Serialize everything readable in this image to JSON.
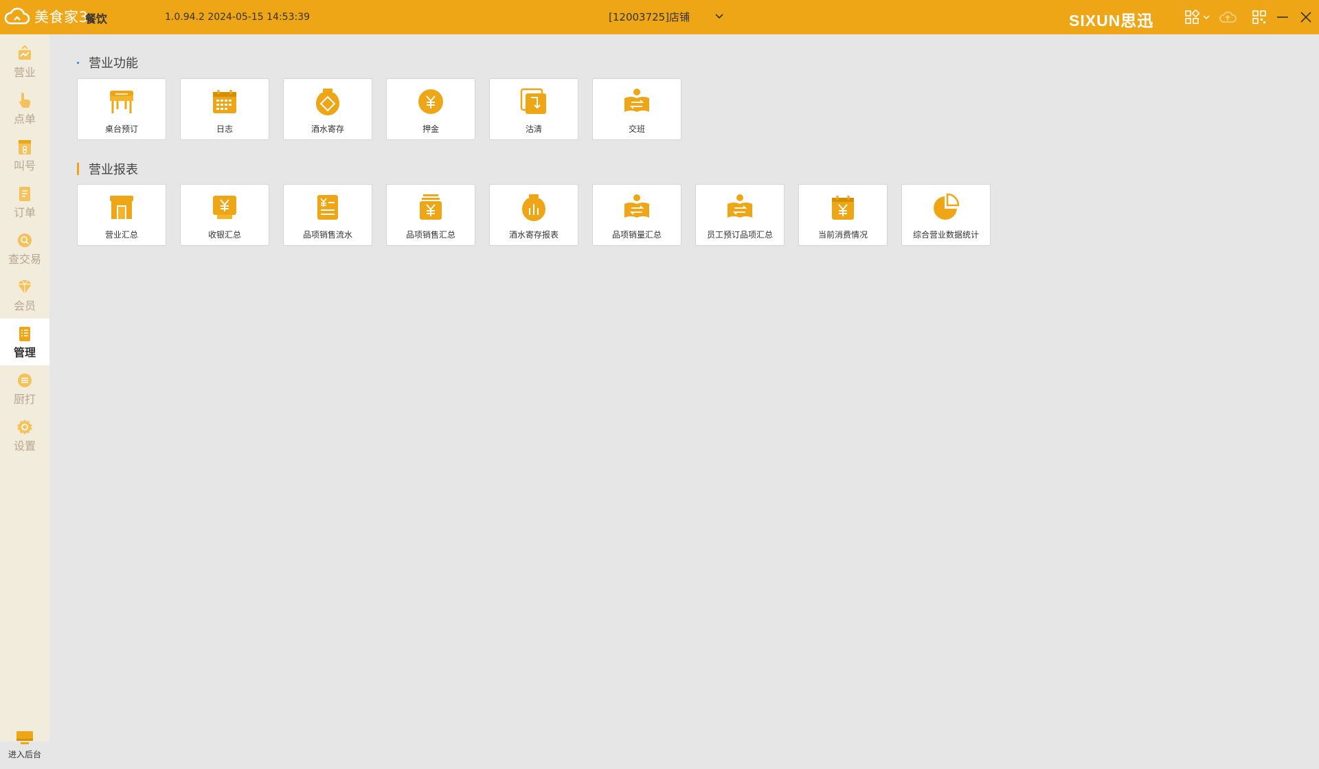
{
  "titlebar": {
    "app_name": "美食家3",
    "mode": "餐饮",
    "version": "1.0.94.2 2024-05-15 14:53:39",
    "store": "[12003725]店铺",
    "brand_text": "SIXUN",
    "brand_cn": "思迅"
  },
  "sidebar": {
    "items": [
      {
        "label": "营业",
        "icon": "business-icon"
      },
      {
        "label": "点单",
        "icon": "order-icon"
      },
      {
        "label": "叫号",
        "icon": "call-number-icon"
      },
      {
        "label": "订单",
        "icon": "orders-list-icon"
      },
      {
        "label": "查交易",
        "icon": "search-transaction-icon"
      },
      {
        "label": "会员",
        "icon": "member-icon"
      },
      {
        "label": "管理",
        "icon": "manage-icon"
      },
      {
        "label": "厨打",
        "icon": "kitchen-print-icon"
      },
      {
        "label": "设置",
        "icon": "settings-icon"
      }
    ],
    "active_index": 6,
    "backend_label": "进入后台"
  },
  "sections": {
    "business_functions": {
      "title": "营业功能",
      "tiles": [
        {
          "label": "桌台预订",
          "icon": "table-reservation-icon"
        },
        {
          "label": "日志",
          "icon": "log-icon"
        },
        {
          "label": "酒水寄存",
          "icon": "drink-storage-icon"
        },
        {
          "label": "押金",
          "icon": "deposit-icon"
        },
        {
          "label": "沽清",
          "icon": "sold-out-icon"
        },
        {
          "label": "交班",
          "icon": "shift-handover-icon"
        }
      ]
    },
    "business_reports": {
      "title": "营业报表",
      "tiles": [
        {
          "label": "营业汇总",
          "icon": "business-summary-icon"
        },
        {
          "label": "收银汇总",
          "icon": "cashier-summary-icon"
        },
        {
          "label": "品项销售流水",
          "icon": "item-sales-flow-icon"
        },
        {
          "label": "品项销售汇总",
          "icon": "item-sales-summary-icon"
        },
        {
          "label": "酒水寄存报表",
          "icon": "drink-storage-report-icon"
        },
        {
          "label": "品项销量汇总",
          "icon": "item-volume-summary-icon"
        },
        {
          "label": "员工预订品项汇总",
          "icon": "staff-reservation-summary-icon"
        },
        {
          "label": "当前消费情况",
          "icon": "current-consumption-icon"
        },
        {
          "label": "综合营业数据统计",
          "icon": "comprehensive-stats-icon"
        }
      ]
    }
  },
  "colors": {
    "accent": "#eea617",
    "sidebar_bg": "#f2ecdc",
    "content_bg": "#e6e6e6"
  }
}
